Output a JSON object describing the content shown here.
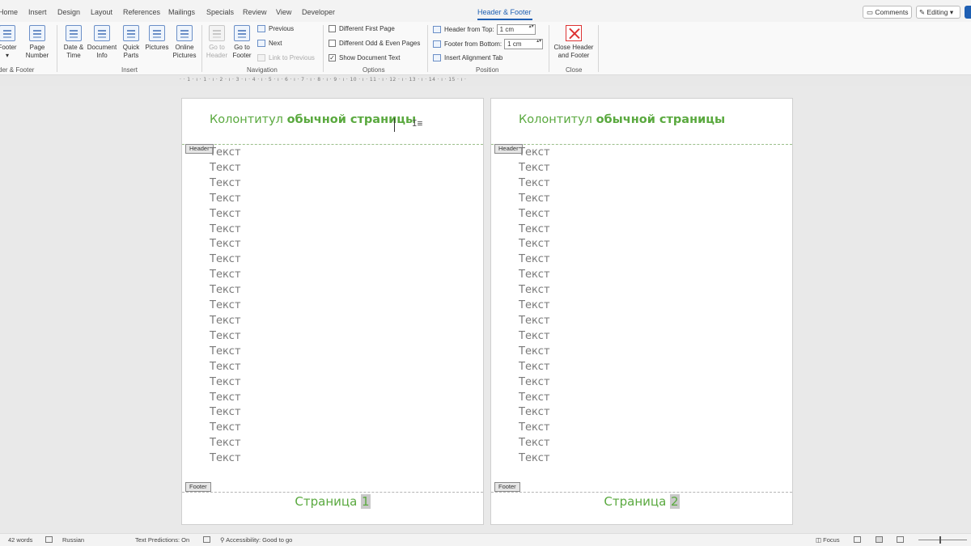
{
  "tabs": {
    "home": "Home",
    "insert": "Insert",
    "design": "Design",
    "layout": "Layout",
    "references": "References",
    "mailings": "Mailings",
    "specials": "Specials",
    "review": "Review",
    "view": "View",
    "developer": "Developer",
    "header_footer": "Header & Footer"
  },
  "topright": {
    "comments": "Comments",
    "editing": "Editing"
  },
  "ribbon": {
    "hf_group": {
      "footer": "Footer",
      "page_number": "Page Number",
      "label": "der & Footer"
    },
    "insert_group": {
      "date_time": "Date & Time",
      "document_info": "Document Info",
      "quick_parts": "Quick Parts",
      "pictures": "Pictures",
      "online_pictures": "Online Pictures",
      "label": "Insert"
    },
    "navigation": {
      "go_to_header": "Go to Header",
      "go_to_footer": "Go to Footer",
      "previous": "Previous",
      "next": "Next",
      "link_to_previous": "Link to Previous",
      "label": "Navigation"
    },
    "options": {
      "different_first_page": "Different First Page",
      "different_odd_even": "Different Odd & Even Pages",
      "show_document_text": "Show Document Text",
      "label": "Options"
    },
    "position": {
      "header_from_top": "Header from Top:",
      "header_from_top_value": "1 cm",
      "footer_from_bottom": "Footer from Bottom:",
      "footer_from_bottom_value": "1 cm",
      "insert_alignment_tab": "Insert Alignment Tab",
      "label": "Position"
    },
    "close": {
      "close_header_footer": "Close Header and Footer",
      "label": "Close"
    }
  },
  "ruler": "· · 1 · ı · 1 · ı · 2 · ı · 3 · ı · 4 · ı · 5 · ı · 6 · ı · 7 · ı · 8 · ı · 9 · ı · 10 · ı · 11 · ı · 12 · ı · 13 · ı · 14 · ı · 15 · ı · 16 · ı",
  "pages": [
    {
      "header_regular": "Колонтитул ",
      "header_bold": "обычной страницы",
      "header_tag": "Header",
      "body_lines": [
        "Текст",
        "Текст",
        "Текст",
        "Текст",
        "Текст",
        "Текст",
        "Текст",
        "Текст",
        "Текст",
        "Текст",
        "Текст",
        "Текст",
        "Текст",
        "Текст",
        "Текст",
        "Текст",
        "Текст",
        "Текст",
        "Текст",
        "Текст",
        "Текст"
      ],
      "footer_tag": "Footer",
      "footer_label": "Страница ",
      "footer_number": "1"
    },
    {
      "header_regular": "Колонтитул ",
      "header_bold": "обычной страницы",
      "header_tag": "Header",
      "body_lines": [
        "Текст",
        "Текст",
        "Текст",
        "Текст",
        "Текст",
        "Текст",
        "Текст",
        "Текст",
        "Текст",
        "Текст",
        "Текст",
        "Текст",
        "Текст",
        "Текст",
        "Текст",
        "Текст",
        "Текст",
        "Текст",
        "Текст",
        "Текст",
        "Текст"
      ],
      "footer_tag": "Footer",
      "footer_label": "Страница ",
      "footer_number": "2"
    }
  ],
  "statusbar": {
    "words": "42 words",
    "language": "Russian",
    "text_predictions": "Text Predictions: On",
    "accessibility": "Accessibility: Good to go",
    "focus": "Focus"
  },
  "colors": {
    "accent": "#1e5fb3",
    "header_green": "#5aa93f",
    "body_gray": "#7a7a7a"
  }
}
